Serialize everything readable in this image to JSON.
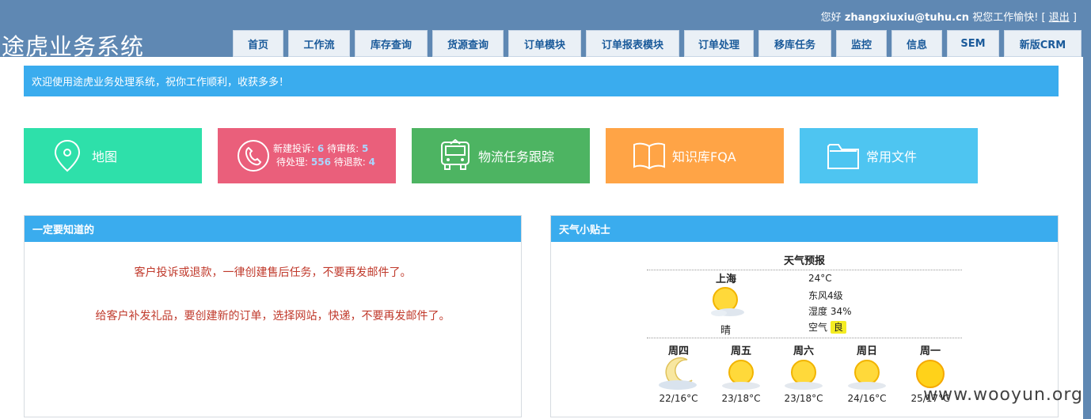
{
  "header": {
    "greeting": "您好",
    "username": "zhangxiuxiu@tuhu.cn",
    "wish": "祝您工作愉快!",
    "bracket_open": "[",
    "logout": "退出",
    "bracket_close": "]",
    "title": "途虎业务系统",
    "bg_color": "#5f88b3"
  },
  "nav": [
    {
      "label": "首页"
    },
    {
      "label": "工作流"
    },
    {
      "label": "库存查询"
    },
    {
      "label": "货源查询"
    },
    {
      "label": "订单模块"
    },
    {
      "label": "订单报表模块"
    },
    {
      "label": "订单处理"
    },
    {
      "label": "移库任务"
    },
    {
      "label": "监控"
    },
    {
      "label": "信息"
    },
    {
      "label": "SEM"
    },
    {
      "label": "新版CRM"
    }
  ],
  "welcome": "欢迎使用途虎业务处理系统，祝你工作顺利，收获多多！",
  "tiles": {
    "map": {
      "label": "地图",
      "icon": "map-pin-icon",
      "color": "#2ee0aa"
    },
    "complaints": {
      "icon": "phone-icon",
      "color": "#ea5f7b",
      "new_label": "新建投诉:",
      "new_count": "6",
      "review_label": "待审核:",
      "review_count": "5",
      "pending_label": "待处理:",
      "pending_count": "556",
      "refund_label": "待退款:",
      "refund_count": "4"
    },
    "logistics": {
      "label": "物流任务跟踪",
      "icon": "truck-icon",
      "color": "#4db462"
    },
    "knowledge": {
      "label": "知识库FQA",
      "icon": "book-icon",
      "color": "#ffa446"
    },
    "files": {
      "label": "常用文件",
      "icon": "folder-icon",
      "color": "#4ec5f1"
    }
  },
  "notice_panel": {
    "title": "一定要知道的",
    "lines": [
      "客户投诉或退款，一律创建售后任务，不要再发邮件了。",
      "给客户补发礼品，要创建新的订单，选择网站，快递，不要再发邮件了。"
    ]
  },
  "weather_panel": {
    "title": "天气小贴士",
    "heading": "天气预报",
    "city": "上海",
    "condition": "晴",
    "temperature": "24°C",
    "wind": "东风4级",
    "humidity": "湿度 34%",
    "air_label": "空气",
    "air_value": "良",
    "forecast": [
      {
        "day": "周四",
        "temp": "22/16°C",
        "icon": "moon-cloud-icon"
      },
      {
        "day": "周五",
        "temp": "23/18°C",
        "icon": "sun-cloud-icon"
      },
      {
        "day": "周六",
        "temp": "23/18°C",
        "icon": "sun-cloud-icon"
      },
      {
        "day": "周日",
        "temp": "24/16°C",
        "icon": "sun-cloud-icon"
      },
      {
        "day": "周一",
        "temp": "25/17°C",
        "icon": "sun-icon"
      }
    ]
  },
  "watermark": "www.wooyun.org"
}
